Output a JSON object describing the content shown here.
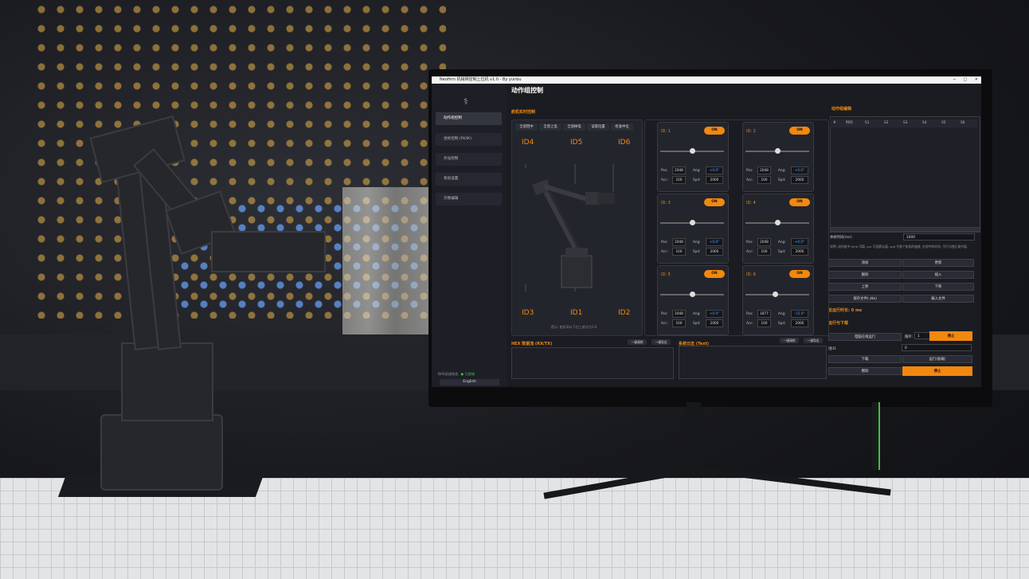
{
  "window": {
    "title": "Neofirm 机械臂控制上位机 v1.0 - By yunbu",
    "controls": [
      "─",
      "□",
      "✕"
    ]
  },
  "sidebar": {
    "logo": "⚕",
    "items": [
      "动作组控制",
      "坐标控制 (FK/IK)",
      "外设控制",
      "系统设置",
      "示教编辑"
    ],
    "bus_label": "BUS总线状态",
    "bus_status": "● 已就绪",
    "language": "English"
  },
  "page_title": "动作组控制",
  "realtime": {
    "title": "舵机实时控制",
    "quick_buttons": [
      "全部回中",
      "全部上电",
      "全部掉电",
      "读取位置",
      "校准中位"
    ],
    "id_labels": [
      "ID4",
      "ID5",
      "ID6",
      "ID3",
      "ID1",
      "ID2"
    ],
    "hint": "提示: 舵机ID从下往上依次为1-6"
  },
  "servos": [
    {
      "id": "ID: 1",
      "toggle": "ON",
      "pos": "2048",
      "ang": "+0.0°",
      "acc": "100",
      "spd": "2000",
      "level": 0.5
    },
    {
      "id": "ID: 2",
      "toggle": "ON",
      "pos": "2048",
      "ang": "+0.0°",
      "acc": "100",
      "spd": "2000",
      "level": 0.5
    },
    {
      "id": "ID: 3",
      "toggle": "ON",
      "pos": "2048",
      "ang": "+0.0°",
      "acc": "100",
      "spd": "2000",
      "level": 0.5
    },
    {
      "id": "ID: 4",
      "toggle": "ON",
      "pos": "2048",
      "ang": "+0.0°",
      "acc": "100",
      "spd": "2000",
      "level": 0.5
    },
    {
      "id": "ID: 5",
      "toggle": "ON",
      "pos": "2048",
      "ang": "+0.0°",
      "acc": "100",
      "spd": "2000",
      "level": 0.5
    },
    {
      "id": "ID: 6",
      "toggle": "ON",
      "pos": "1877",
      "ang": "-15.0°",
      "acc": "100",
      "spd": "2000",
      "level": 0.46
    }
  ],
  "servo_field_labels": {
    "pos": "Pos:",
    "ang": "Ang:",
    "acc": "Acc:",
    "spd": "Spd:"
  },
  "hex": {
    "title": "HEX 数据流 (RX/TX)",
    "clear": "一键清除",
    "save": "一键导出"
  },
  "log": {
    "title": "系统日志 (Text)",
    "clear": "一键清除",
    "save": "一键导出"
  },
  "action_editor": {
    "title": "动作组编辑",
    "columns": [
      "#",
      "时间",
      "S1",
      "S2",
      "S3",
      "S4",
      "S5",
      "S6"
    ],
    "frame_time_label": "本帧时间(ms):",
    "frame_time_value": "1000",
    "note": "说明: 动作组中 time 可填, acc 可选默认值, spd 为各个舵机的速度, 在帧中的时间, 不行为独立调节值.",
    "buttons": [
      "添加",
      "更新",
      "删除",
      "插入",
      "上移",
      "下移",
      "保存文件(.dta)",
      "载入文件"
    ],
    "total_time": "总运行时长: 0 ms"
  },
  "run": {
    "title": "运行与下载",
    "online_run": "电脑在线运行",
    "loop_label": "循环:",
    "loop_value": "1",
    "stop": "停止",
    "group_id_label": "组ID:",
    "group_id_value": "0",
    "download": "下载",
    "run_offline": "运行(板载)",
    "erase": "擦除",
    "stop2": "停止"
  }
}
